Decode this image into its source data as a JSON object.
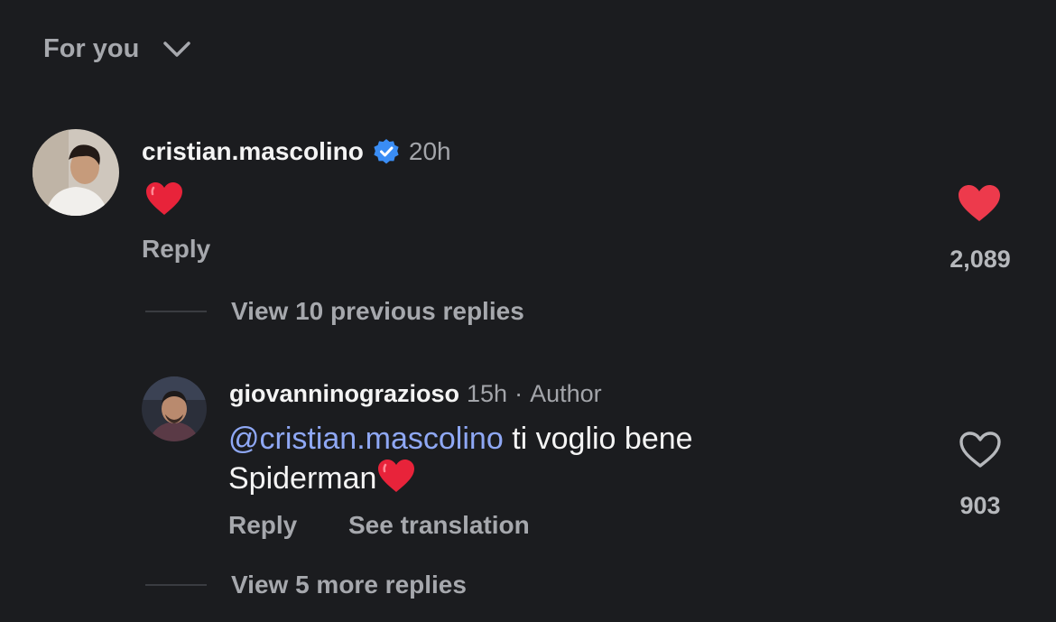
{
  "header": {
    "label": "For you"
  },
  "comment": {
    "username": "cristian.mascolino",
    "time": "20h",
    "body_emoji": "red-heart",
    "reply_label": "Reply",
    "like_count": "2,089",
    "liked": true
  },
  "view_previous": {
    "label": "View 10 previous replies"
  },
  "reply": {
    "username": "giovanninograzioso",
    "time": "15h",
    "separator": "·",
    "author_badge": "Author",
    "mention": "@cristian.mascolino",
    "text_line1": "ti voglio bene",
    "text_line2": "Spiderman",
    "reply_label": "Reply",
    "translate_label": "See translation",
    "like_count": "903",
    "liked": false
  },
  "view_more": {
    "label": "View 5 more replies"
  },
  "colors": {
    "like_red": "#ed3a4c",
    "verified_blue": "#3a8df5",
    "mention_blue": "#8fa8f5"
  }
}
